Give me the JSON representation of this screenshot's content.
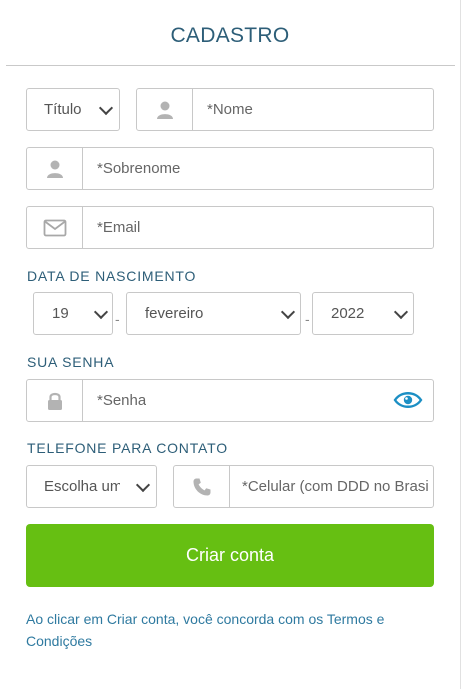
{
  "form": {
    "title": "CADASTRO",
    "titulo_select": "Título",
    "name_placeholder": "*Nome",
    "surname_placeholder": "*Sobrenome",
    "email_placeholder": "*Email",
    "birth_label": "DATA DE NASCIMENTO",
    "birth_day": "19",
    "birth_month": "fevereiro",
    "birth_year": "2022",
    "dash": "-",
    "password_label": "SUA SENHA",
    "password_placeholder": "*Senha",
    "phone_label": "TELEFONE PARA CONTATO",
    "phone_country_select": "Escolha um",
    "phone_placeholder": "*Celular (com DDD no Brasil)",
    "submit_label": "Criar conta",
    "terms_text": "Ao clicar em Criar conta, você concorda com os Termos e Condições"
  },
  "colors": {
    "accent": "#2d5e78",
    "button": "#66bf12",
    "link": "#2f7aa0",
    "eye_icon": "#1c8fc4"
  },
  "icons": [
    "user-icon",
    "envelope-icon",
    "lock-icon",
    "eye-icon",
    "phone-icon",
    "chevron-down-icon"
  ]
}
